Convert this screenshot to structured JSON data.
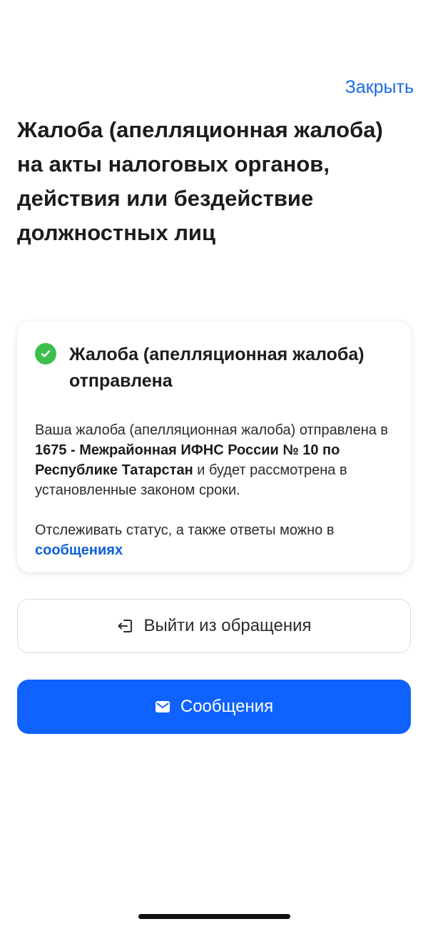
{
  "header": {
    "close_label": "Закрыть"
  },
  "page": {
    "title": "Жалоба (апелляционная жалоба) на акты налоговых органов, действия или бездействие должностных лиц"
  },
  "status_card": {
    "icon": "check-circle-icon",
    "title": "Жалоба (апелляционная жалоба) отправлена",
    "body_prefix": "Ваша жалоба (апелляционная жалоба) отправлена в ",
    "authority": "1675 - Межрайонная ИФНС России № 10 по Республике Татарстан",
    "body_suffix": " и будет рассмотрена в установленные законом сроки.",
    "tracking_text": "Отслеживать статус, а также ответы можно в ",
    "messages_link": "сообщениях"
  },
  "actions": {
    "exit_label": "Выйти из обращения",
    "exit_icon": "exit-icon",
    "messages_label": "Сообщения",
    "messages_icon": "envelope-icon"
  },
  "colors": {
    "accent": "#0f62fe",
    "link": "#1a6ae3",
    "success": "#3dbf4e"
  }
}
